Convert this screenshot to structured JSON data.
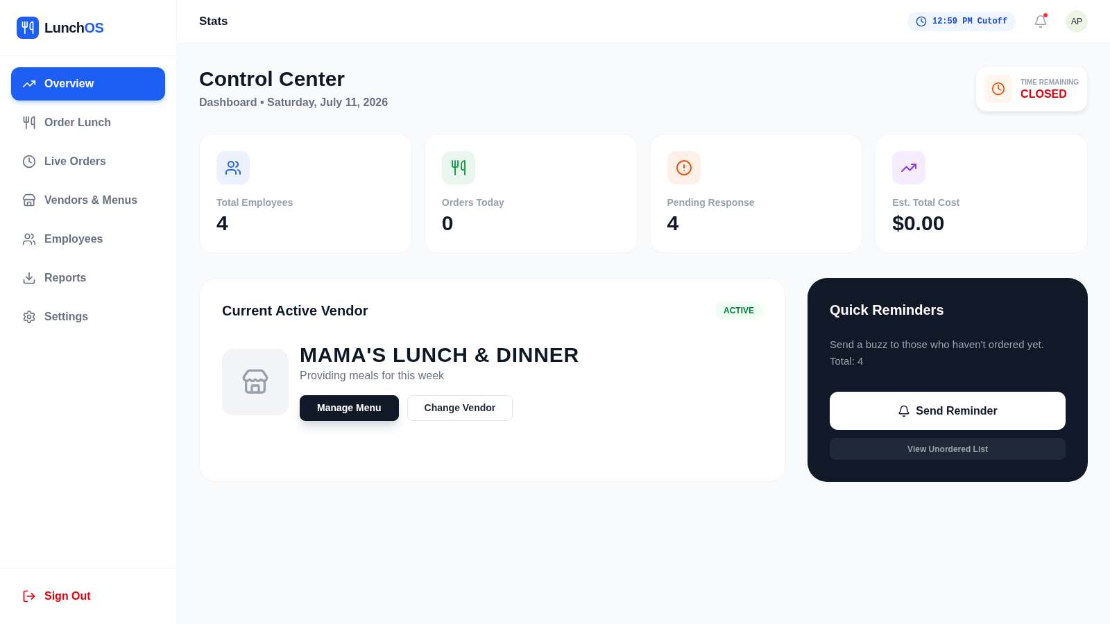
{
  "sidebar": {
    "logo": {
      "text": "Lunch",
      "accent": "OS"
    },
    "nav": [
      {
        "label": "Overview",
        "selected": true
      },
      {
        "label": "Order Lunch",
        "selected": false
      },
      {
        "label": "Live Orders",
        "selected": false
      },
      {
        "label": "Vendors & Menus",
        "selected": false
      },
      {
        "label": "Employees",
        "selected": false
      },
      {
        "label": "Reports",
        "selected": false
      },
      {
        "label": "Settings",
        "selected": false
      }
    ],
    "sign_out": "Sign Out"
  },
  "header": {
    "title": "Stats",
    "cutoff": "12:59 PM Cutoff",
    "has_unread": true,
    "avatar": "AP"
  },
  "page": {
    "title": "Control Center",
    "subtitle": "Dashboard • Saturday, July 11, 2026",
    "time_remaining": {
      "label": "TIME REMAINING",
      "value": "CLOSED"
    }
  },
  "stats": [
    {
      "label": "Total Employees",
      "value": "4",
      "color": "#2563eb"
    },
    {
      "label": "Orders Today",
      "value": "0",
      "color": "#16a34a"
    },
    {
      "label": "Pending Response",
      "value": "4",
      "color": "#ea580c"
    },
    {
      "label": "Est. Total Cost",
      "value": "$0.00",
      "color": "#9333ea"
    }
  ],
  "vendor_card": {
    "title": "Current Active Vendor",
    "status": "ACTIVE",
    "vendor_name": "MAMA'S LUNCH & DINNER",
    "description": "Providing meals for this week",
    "buttons": [
      {
        "label": "Manage Menu",
        "kind": "primary"
      },
      {
        "label": "Change Vendor",
        "kind": "secondary"
      }
    ]
  },
  "reminders": {
    "title": "Quick Reminders",
    "description": "Send a buzz to those who haven't ordered yet. Total: 4",
    "primary_button": "Send Reminder",
    "secondary_button": "View Unordered List"
  }
}
